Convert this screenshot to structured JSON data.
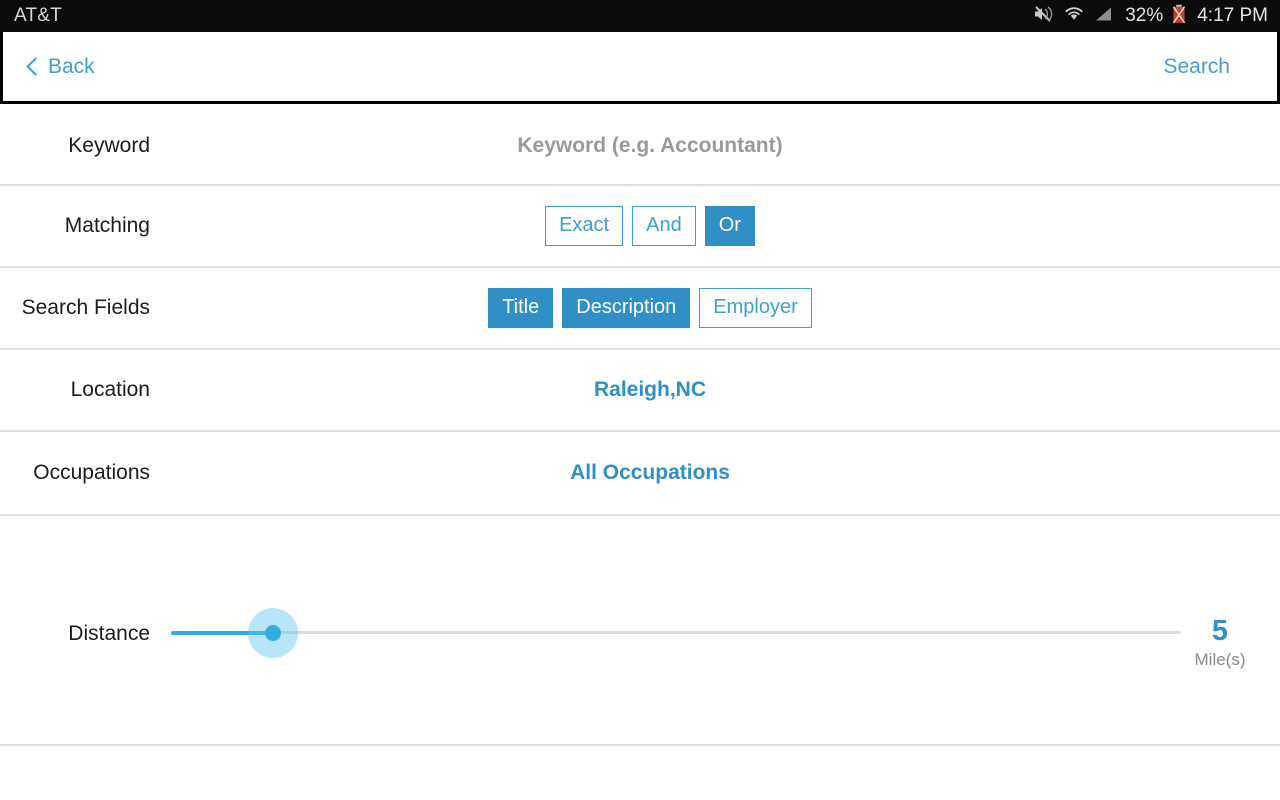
{
  "status_bar": {
    "carrier": "AT&T",
    "battery_percent": "32%",
    "time": "4:17 PM",
    "icons": [
      "mute-icon",
      "wifi-icon",
      "signal-icon",
      "battery-icon"
    ]
  },
  "nav_bar": {
    "back_label": "Back",
    "search_label": "Search"
  },
  "rows": {
    "keyword": {
      "label": "Keyword",
      "value": "",
      "placeholder": "Keyword (e.g. Accountant)"
    },
    "matching": {
      "label": "Matching",
      "options": [
        {
          "label": "Exact",
          "selected": false
        },
        {
          "label": "And",
          "selected": false
        },
        {
          "label": "Or",
          "selected": true
        }
      ]
    },
    "search_fields": {
      "label": "Search Fields",
      "options": [
        {
          "label": "Title",
          "selected": true
        },
        {
          "label": "Description",
          "selected": true
        },
        {
          "label": "Employer",
          "selected": false
        }
      ]
    },
    "location": {
      "label": "Location",
      "value": "Raleigh,NC"
    },
    "occupations": {
      "label": "Occupations",
      "value": "All Occupations"
    },
    "distance": {
      "label": "Distance",
      "value": "5",
      "units": "Mile(s)",
      "slider_min": 0,
      "slider_max": 50,
      "slider_percent": 10
    }
  },
  "colors": {
    "accent_blue": "#2f8fc6",
    "link_blue": "#3f9fd4",
    "slider_blue": "#35ace0",
    "separator": "#e0e0e0",
    "status_bar_bg": "#0b0b0b",
    "placeholder_gray": "#9a9a9a"
  }
}
